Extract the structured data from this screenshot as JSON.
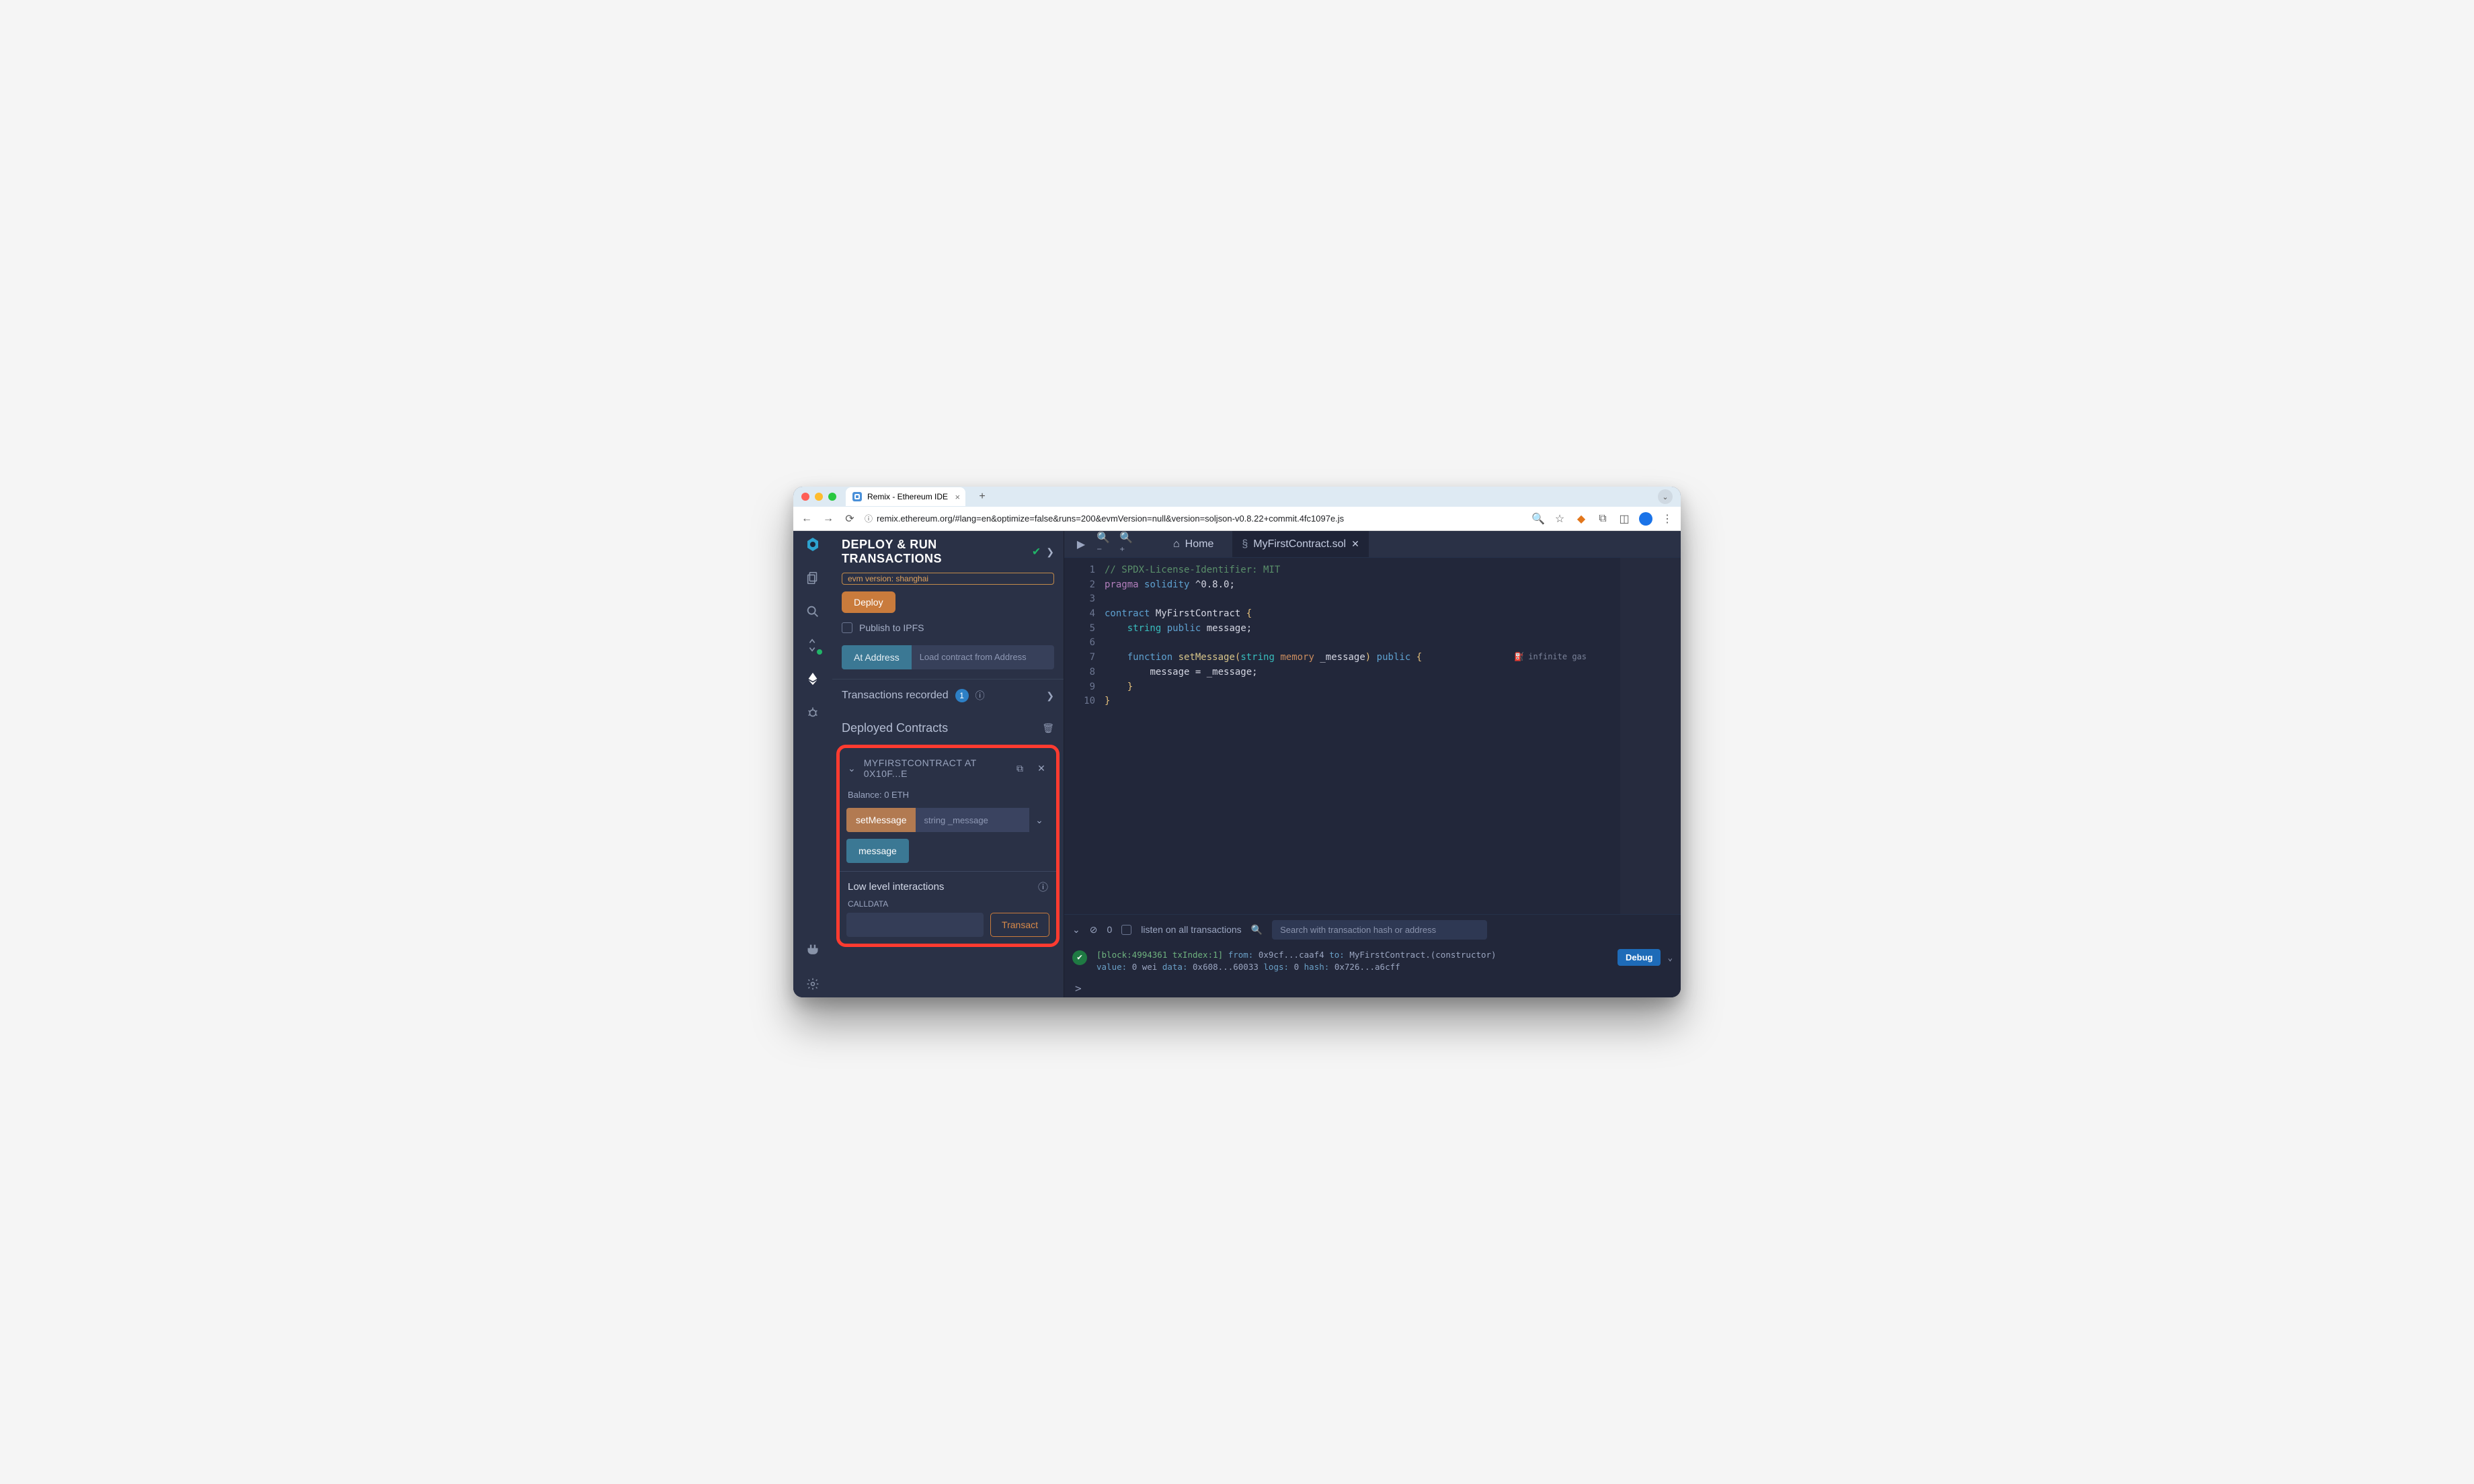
{
  "browser": {
    "tab_title": "Remix - Ethereum IDE",
    "url": "remix.ethereum.org/#lang=en&optimize=false&runs=200&evmVersion=null&version=soljson-v0.8.22+commit.4fc1097e.js"
  },
  "panel": {
    "title": "DEPLOY & RUN TRANSACTIONS",
    "evm_pill": "evm version: shanghai",
    "deploy_btn": "Deploy",
    "publish_ipfs": "Publish to IPFS",
    "at_address_label": "At Address",
    "at_address_placeholder": "Load contract from Address",
    "tx_recorded_label": "Transactions recorded",
    "tx_recorded_count": "1",
    "deployed_label": "Deployed Contracts"
  },
  "contract": {
    "name_line": "MYFIRSTCONTRACT AT 0X10F...E",
    "balance_line": "Balance: 0 ETH",
    "setMessage_label": "setMessage",
    "setMessage_placeholder": "string _message",
    "message_label": "message",
    "lli_label": "Low level interactions",
    "calldata_label": "CALLDATA",
    "transact_label": "Transact"
  },
  "tabs": {
    "home": "Home",
    "file": "MyFirstContract.sol"
  },
  "code": {
    "l1_cm": "// SPDX-License-Identifier: MIT",
    "l2_kw1": "pragma",
    "l2_kw2": "solidity",
    "l2_ver": "^0.8.0;",
    "l4_kw": "contract",
    "l4_name": "MyFirstContract",
    "l4_br": "{",
    "l5_ty": "string",
    "l5_kw": "public",
    "l5_id": "message;",
    "l7_kw1": "function",
    "l7_name": "setMessage",
    "l7_p1": "(",
    "l7_ty1": "string",
    "l7_mem": "memory",
    "l7_arg": "_message",
    "l7_p2": ")",
    "l7_kw2": "public",
    "l7_br": "{",
    "l8": "message = _message;",
    "l9": "}",
    "l10": "}",
    "gas_hint": "infinite gas",
    "lines": [
      "1",
      "2",
      "3",
      "4",
      "5",
      "6",
      "7",
      "8",
      "9",
      "10"
    ]
  },
  "console": {
    "listen_label": "listen on all transactions",
    "count": "0",
    "search_placeholder": "Search with transaction hash or address",
    "debug_label": "Debug",
    "log_block": "[block:4994361 txIndex:1]",
    "log_from_k": "from:",
    "log_from_v": "0x9cf...caaf4",
    "log_to_k": "to:",
    "log_to_v": "MyFirstContract.(constructor)",
    "log_val_k": "value:",
    "log_val_v": "0 wei",
    "log_data_k": "data:",
    "log_data_v": "0x608...60033",
    "log_logs_k": "logs:",
    "log_logs_v": "0",
    "log_hash_k": "hash:",
    "log_hash_v": "0x726...a6cff",
    "prompt": ">"
  }
}
